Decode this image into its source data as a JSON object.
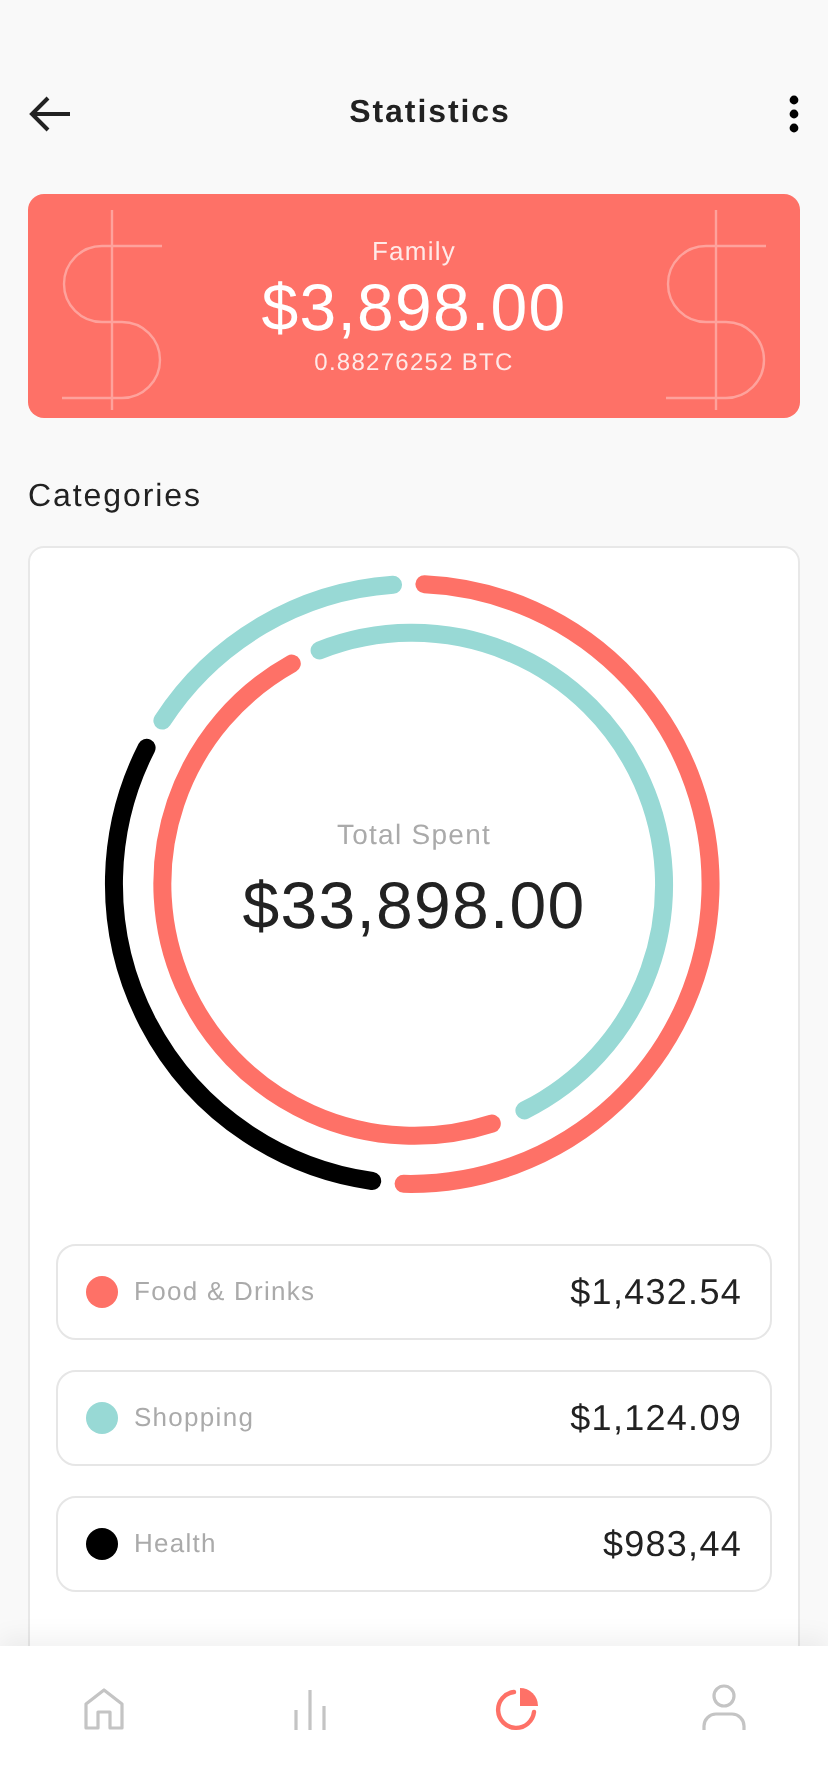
{
  "header": {
    "title": "Statistics"
  },
  "wallet": {
    "name": "Family",
    "amount": "$3,898.00",
    "crypto": "0.88276252 BTC"
  },
  "section_title": "Categories",
  "summary": {
    "label": "Total Spent",
    "amount": "$33,898.00"
  },
  "categories": [
    {
      "name": "Food & Drinks",
      "amount": "$1,432.54",
      "color": "#fe7167"
    },
    {
      "name": "Shopping",
      "amount": "$1,124.09",
      "color": "#98d9d5"
    },
    {
      "name": "Health",
      "amount": "$983,44",
      "color": "#000000"
    }
  ],
  "tab_bar": [
    {
      "kind": "home",
      "selected": false
    },
    {
      "kind": "stats",
      "selected": false
    },
    {
      "kind": "pie",
      "selected": true
    },
    {
      "kind": "profile",
      "selected": false
    }
  ]
}
